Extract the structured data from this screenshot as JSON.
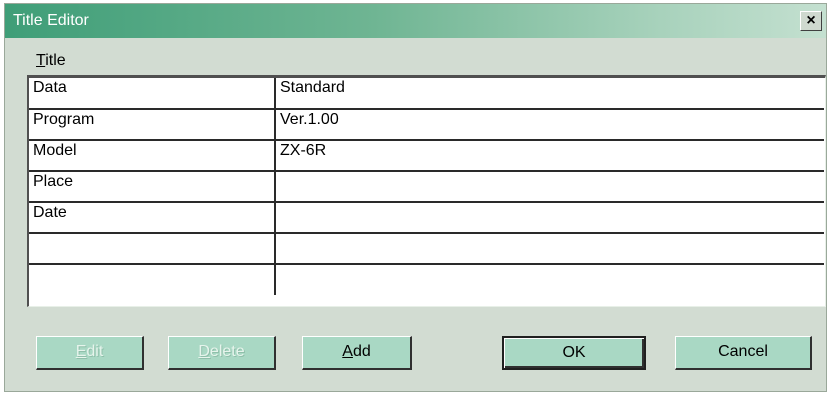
{
  "window": {
    "title": "Title Editor",
    "close_label": "×"
  },
  "menu": {
    "title_first": "T",
    "title_rest": "itle"
  },
  "grid": {
    "rows": [
      {
        "key": "Data",
        "value": "Standard"
      },
      {
        "key": "Program",
        "value": "Ver.1.00"
      },
      {
        "key": "Model",
        "value": "ZX-6R"
      },
      {
        "key": "Place",
        "value": ""
      },
      {
        "key": "Date",
        "value": ""
      },
      {
        "key": "",
        "value": ""
      },
      {
        "key": "",
        "value": ""
      }
    ]
  },
  "buttons": {
    "edit_first": "E",
    "edit_rest": "dit",
    "delete_first": "D",
    "delete_rest": "elete",
    "add_first": "A",
    "add_rest": "dd",
    "ok": "OK",
    "cancel": "Cancel"
  },
  "colors": {
    "titlebar_start": "#3f9e78",
    "titlebar_end": "#c4e0d0",
    "dialog_bg": "#d2dcd2",
    "button_bg": "#a9d8c4"
  }
}
